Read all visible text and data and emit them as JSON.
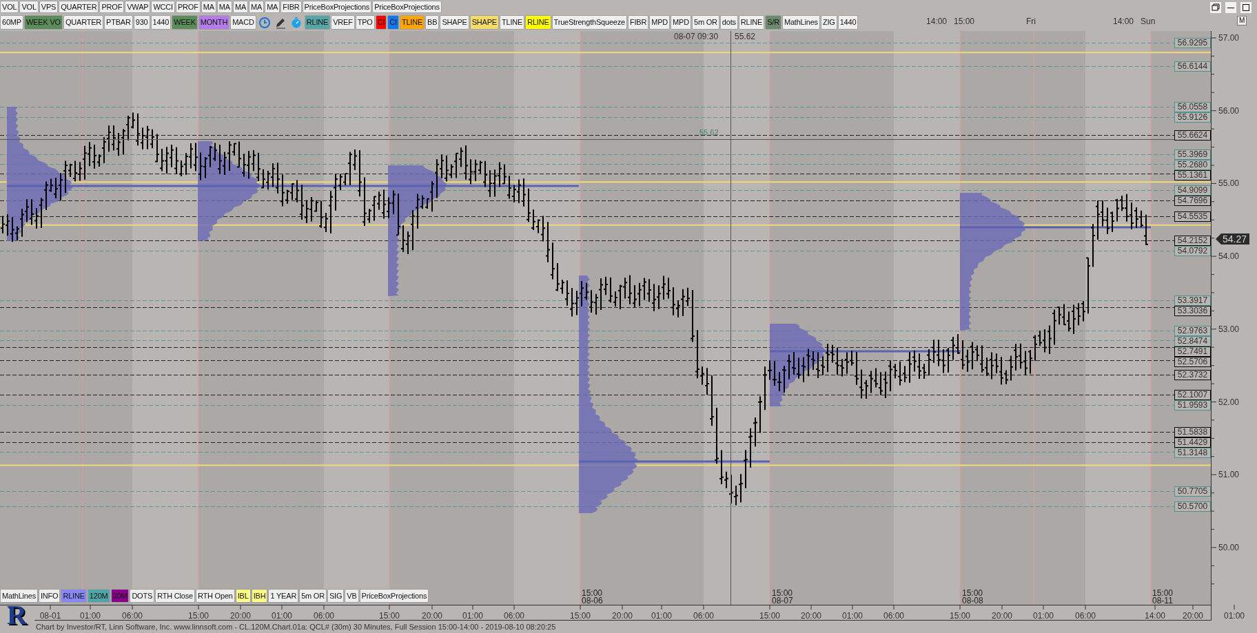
{
  "toolbar_top": [
    {
      "label": "VOL",
      "color": "#efefef"
    },
    {
      "label": "VOL",
      "color": "#efefef"
    },
    {
      "label": "VPS",
      "color": "#efefef"
    },
    {
      "label": "QUARTER",
      "color": "#efefef"
    },
    {
      "label": "PROF",
      "color": "#efefef"
    },
    {
      "label": "VWAP",
      "color": "#efefef"
    },
    {
      "label": "WCCI",
      "color": "#efefef"
    },
    {
      "label": "PROF",
      "color": "#efefef"
    },
    {
      "label": "MA",
      "color": "#efefef"
    },
    {
      "label": "MA",
      "color": "#efefef"
    },
    {
      "label": "MA",
      "color": "#efefef"
    },
    {
      "label": "MA",
      "color": "#efefef"
    },
    {
      "label": "MA",
      "color": "#efefef"
    },
    {
      "label": "FIBR",
      "color": "#efefef"
    },
    {
      "label": "PriceBoxProjections",
      "color": "#efefef"
    },
    {
      "label": "PriceBoxProjections",
      "color": "#efefef"
    }
  ],
  "toolbar_indicators": {
    "before_icons": [
      {
        "label": "60MP",
        "color": "#efefef"
      },
      {
        "label": "WEEK VO",
        "color": "#5b8c5a"
      },
      {
        "label": "QUARTER",
        "color": "#efefef"
      },
      {
        "label": "PTBAR",
        "color": "#efefef"
      },
      {
        "label": "930",
        "color": "#efefef"
      },
      {
        "label": "1440",
        "color": "#efefef"
      },
      {
        "label": "WEEK",
        "color": "#5b8c5a"
      },
      {
        "label": "MONTH",
        "color": "#b57be8"
      },
      {
        "label": "MACD",
        "color": "#efefef"
      }
    ],
    "after_icons": [
      {
        "label": "RLINE",
        "color": "#58a5a5"
      },
      {
        "label": "VREF",
        "color": "#efefef"
      },
      {
        "label": "TPO",
        "color": "#efefef"
      },
      {
        "label": "CI",
        "color": "#ff0000"
      },
      {
        "label": "CI",
        "color": "#1177ee"
      },
      {
        "label": "TLINE",
        "color": "#ffa500"
      },
      {
        "label": "BB",
        "color": "#efefef"
      },
      {
        "label": "SHAPE",
        "color": "#efefef"
      },
      {
        "label": "SHAPE",
        "color": "#f5dc6a"
      },
      {
        "label": "TLINE",
        "color": "#efefef"
      },
      {
        "label": "RLINE",
        "color": "#ffff00"
      },
      {
        "label": "TrueStrengthSqueeze",
        "color": "#efefef"
      },
      {
        "label": "FIBR",
        "color": "#efefef"
      },
      {
        "label": "MPD",
        "color": "#efefef"
      },
      {
        "label": "MPD",
        "color": "#efefef"
      },
      {
        "label": "5m OR",
        "color": "#efefef"
      },
      {
        "label": "dots",
        "color": "#efefef"
      },
      {
        "label": "RLINE",
        "color": "#efefef"
      },
      {
        "label": "S/R",
        "color": "#6b8a6b"
      },
      {
        "label": "MathLines",
        "color": "#efefef"
      },
      {
        "label": "ZIG",
        "color": "#efefef"
      },
      {
        "label": "1440",
        "color": "#efefef"
      }
    ]
  },
  "toolbar_bottom": [
    {
      "label": "MathLines",
      "color": "#efefef"
    },
    {
      "label": "INFO",
      "color": "#efefef"
    },
    {
      "label": "RLINE",
      "color": "#8787f5"
    },
    {
      "label": "120M",
      "color": "#4fa6a6"
    },
    {
      "label": "30M",
      "color": "#8b008b"
    },
    {
      "label": "DOTS",
      "color": "#efefef"
    },
    {
      "label": "RTH Close",
      "color": "#efefef"
    },
    {
      "label": "RTH Open",
      "color": "#efefef"
    },
    {
      "label": "IBL",
      "color": "#ffff88"
    },
    {
      "label": "IBH",
      "color": "#ffff88"
    },
    {
      "label": "1 YEAR",
      "color": "#efefef"
    },
    {
      "label": "5m OR",
      "color": "#efefef"
    },
    {
      "label": "SIG",
      "color": "#efefef"
    },
    {
      "label": "VB",
      "color": "#efefef"
    },
    {
      "label": "PriceBoxProjections",
      "color": "#efefef"
    }
  ],
  "chart": {
    "top_time_labels": [
      "14:00",
      "15:00",
      "Fri",
      "14:00",
      "Sun"
    ],
    "panel_button": "M",
    "crosshair": {
      "time": "08-07 09:30",
      "price": "55.62"
    },
    "crosshair_line_label": "55.62",
    "price_labels": [
      {
        "text": "56.9295",
        "color": "#4a9090"
      },
      {
        "text": "56.6144",
        "color": "#4a9090"
      },
      {
        "text": "56.0558",
        "color": "#4a9090"
      },
      {
        "text": "55.9126",
        "color": "#4a9090"
      },
      {
        "text": "55.6624",
        "color": "#000000"
      },
      {
        "text": "55.3969",
        "color": "#4a9090"
      },
      {
        "text": "55.2680",
        "color": "#4a9090"
      },
      {
        "text": "55.1361",
        "color": "#000000"
      },
      {
        "text": "54.9099",
        "color": "#4a9090"
      },
      {
        "text": "54.7696",
        "color": "#000000"
      },
      {
        "text": "54.5535",
        "color": "#000000"
      },
      {
        "text": "54.2152",
        "color": "#000000"
      },
      {
        "text": "54.0792",
        "color": "#4a9090"
      },
      {
        "text": "53.3917",
        "color": "#4a9090"
      },
      {
        "text": "53.3036",
        "color": "#000000"
      },
      {
        "text": "52.9763",
        "color": "#4a9090"
      },
      {
        "text": "52.8474",
        "color": "#4a9090"
      },
      {
        "text": "52.7491",
        "color": "#000000"
      },
      {
        "text": "52.5706",
        "color": "#000000"
      },
      {
        "text": "52.3732",
        "color": "#000000"
      },
      {
        "text": "52.1007",
        "color": "#000000"
      },
      {
        "text": "51.9593",
        "color": "#4a9090"
      },
      {
        "text": "51.5838",
        "color": "#000000"
      },
      {
        "text": "51.4429",
        "color": "#000000"
      },
      {
        "text": "51.3148",
        "color": "#4a9090"
      },
      {
        "text": "50.7705",
        "color": "#4a9090"
      },
      {
        "text": "50.5700",
        "color": "#4a9090"
      }
    ],
    "last_price": "54.27",
    "price_axis": [
      "57.00",
      "56.00",
      "55.00",
      "54.00",
      "53.00",
      "52.00",
      "51.00",
      "50.00"
    ],
    "session_labels": [
      {
        "time": "15:00",
        "date": "08-06"
      },
      {
        "time": "15:00",
        "date": "08-07"
      },
      {
        "time": "15:00",
        "date": "08-08"
      },
      {
        "time": "15:00",
        "date": "08-11"
      }
    ],
    "time_axis": [
      "08-01",
      "01:00",
      "06:00",
      "15:00",
      "20:00",
      "01:00",
      "06:00",
      "15:00",
      "20:00",
      "01:00",
      "06:00",
      "15:00",
      "20:00",
      "01:00",
      "06:00",
      "15:00",
      "20:00",
      "01:00",
      "06:00",
      "15:00",
      "20:00",
      "01:00",
      "06:00",
      "14:00",
      "20:00",
      "01:00"
    ]
  },
  "logo_text": "R",
  "status_bar": "Chart by Investor/RT, Linn Software, Inc. www.linnsoft.com - CL.120M.Chart.01a: QCL# (30m) 30 Minutes, Full Session 15:00-14:00 - 2019-08-10 08:20:25"
}
